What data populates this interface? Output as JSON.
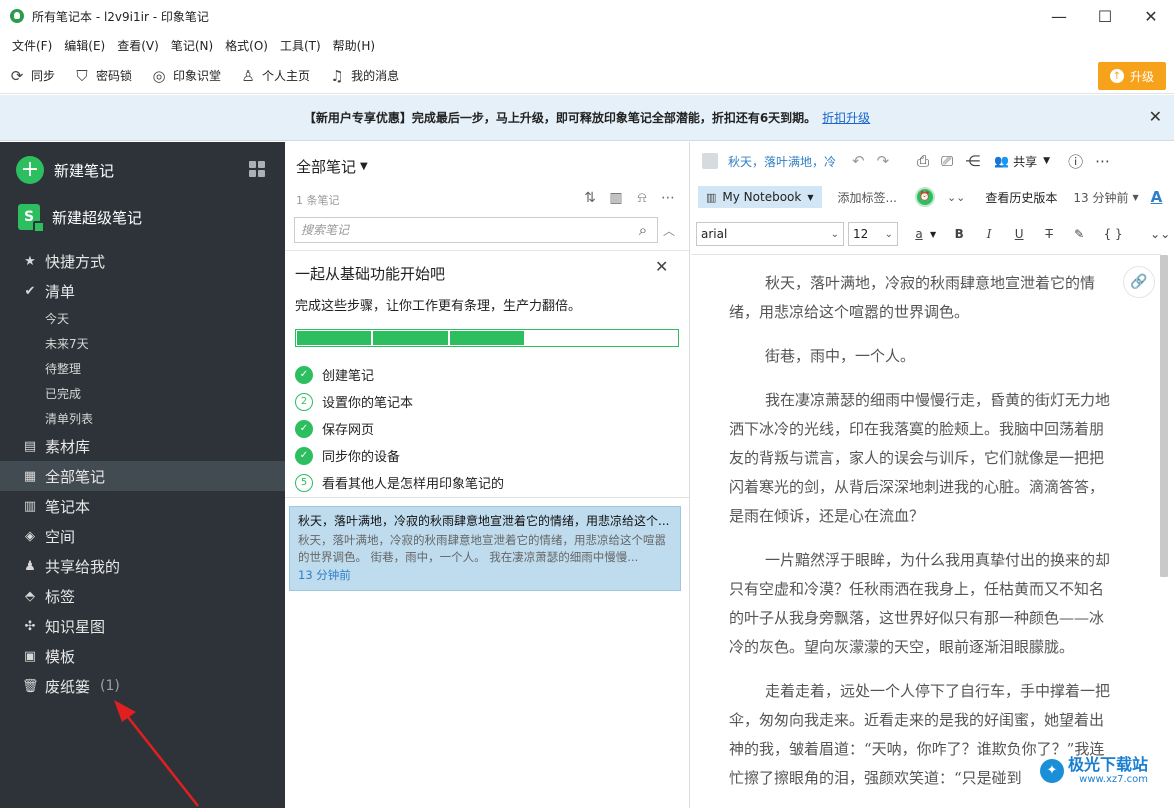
{
  "window": {
    "title": "所有笔记本 - l2v9i1ir - 印象笔记",
    "minimize": "—",
    "maximize": "☐",
    "close": "✕"
  },
  "menu": [
    "文件(F)",
    "编辑(E)",
    "查看(V)",
    "笔记(N)",
    "格式(O)",
    "工具(T)",
    "帮助(H)"
  ],
  "toolbar": {
    "items": [
      {
        "label": "同步",
        "icon": "sync-icon"
      },
      {
        "label": "密码锁",
        "icon": "lock-icon"
      },
      {
        "label": "印象识堂",
        "icon": "learning-icon"
      },
      {
        "label": "个人主页",
        "icon": "user-icon"
      },
      {
        "label": "我的消息",
        "icon": "bell-icon"
      }
    ],
    "upgrade_label": "升级"
  },
  "banner": {
    "text": "【新用户专享优惠】完成最后一步，马上升级，即可释放印象笔记全部潜能，折扣还有6天到期。",
    "link": "折扣升级"
  },
  "sidebar": {
    "new_note": "新建笔记",
    "new_super_note": "新建超级笔记",
    "super_icon_letter": "S",
    "shortcuts": "快捷方式",
    "checklist": "清单",
    "checklist_subs": [
      "今天",
      "未来7天",
      "待整理",
      "已完成",
      "清单列表"
    ],
    "items": [
      {
        "label": "素材库",
        "icon": "library-icon"
      },
      {
        "label": "全部笔记",
        "icon": "all-notes-icon",
        "active": true
      },
      {
        "label": "笔记本",
        "icon": "notebook-icon"
      },
      {
        "label": "空间",
        "icon": "space-icon"
      },
      {
        "label": "共享给我的",
        "icon": "shared-icon"
      },
      {
        "label": "标签",
        "icon": "tag-icon"
      },
      {
        "label": "知识星图",
        "icon": "knowledge-map-icon"
      },
      {
        "label": "模板",
        "icon": "template-icon"
      }
    ],
    "trash": {
      "label": "废纸篓",
      "count": "(1)"
    }
  },
  "note_list": {
    "title": "全部笔记",
    "count": "1 条笔记",
    "search_placeholder": "搜索笔记",
    "onboarding": {
      "title": "一起从基础功能开始吧",
      "subtitle": "完成这些步骤，让你工作更有条理，生产力翻倍。",
      "progress_segments_done": 3,
      "progress_segments_total": 5,
      "steps": [
        {
          "label": "创建笔记",
          "done": true,
          "marker": "✓"
        },
        {
          "label": "设置你的笔记本",
          "done": false,
          "marker": "2"
        },
        {
          "label": "保存网页",
          "done": true,
          "marker": "✓"
        },
        {
          "label": "同步你的设备",
          "done": true,
          "marker": "✓"
        },
        {
          "label": "看看其他人是怎样用印象笔记的",
          "done": false,
          "marker": "5"
        }
      ]
    },
    "note": {
      "title": "秋天，落叶满地，冷寂的秋雨肆意地宣泄着它的情绪，用悲凉给这个...",
      "snippet": "秋天，落叶满地，冷寂的秋雨肆意地宣泄着它的情绪，用悲凉给这个喧嚣的世界调色。 街巷，雨中，一个人。 我在凄凉萧瑟的细雨中慢慢...",
      "time": "13 分钟前"
    }
  },
  "editor": {
    "note_name": "秋天，落叶满地，冷",
    "share_label": "共享",
    "notebook": "My Notebook",
    "add_tag": "添加标签...",
    "history": "查看历史版本",
    "edited_time": "13 分钟前",
    "font_a": "A",
    "font": "arial",
    "size": "12",
    "color_a": "a",
    "format": {
      "bold": "B",
      "italic": "I",
      "underline": "U",
      "strike": "T",
      "code": "{ }"
    },
    "paragraphs": [
      "秋天，落叶满地，冷寂的秋雨肆意地宣泄着它的情绪，用悲凉给这个喧嚣的世界调色。",
      "街巷，雨中，一个人。",
      "我在凄凉萧瑟的细雨中慢慢行走，昏黄的街灯无力地洒下冰冷的光线，印在我落寞的脸颊上。我脑中回荡着朋友的背叛与谎言，家人的误会与训斥，它们就像是一把把闪着寒光的剑，从背后深深地刺进我的心脏。滴滴答答，是雨在倾诉，还是心在流血？",
      "一片黯然浮于眼眸，为什么我用真挚付出的换来的却只有空虚和冷漠？任秋雨洒在我身上，任枯黄而又不知名的叶子从我身旁飘落，这世界好似只有那一种颜色——冰冷的灰色。望向灰濛濛的天空，眼前逐渐泪眼朦胧。",
      "走着走着，远处一个人停下了自行车，手中撑着一把伞，匆匆向我走来。近看走来的是我的好闺蜜，她望着出神的我，皱着眉道：“天呐，你咋了？谁欺负你了？”我连忙擦了擦眼角的泪，强颜欢笑道：“只是碰到"
    ]
  },
  "watermark": {
    "title": "极光下载站",
    "url": "www.xz7.com"
  },
  "colors": {
    "accent_green": "#2dbe60",
    "sidebar_bg": "#2d3338",
    "upgrade_orange": "#f7a21b",
    "link_blue": "#2f7fc6"
  }
}
